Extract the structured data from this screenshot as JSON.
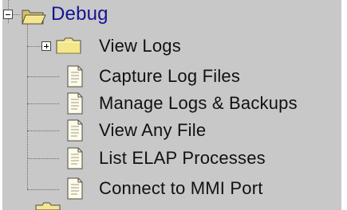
{
  "tree": {
    "root": {
      "label": "Debug",
      "icon": "open-folder-icon",
      "expander": "minus"
    },
    "children": [
      {
        "label": "View Logs",
        "icon": "folder-icon",
        "expander": "plus"
      },
      {
        "label": "Capture Log Files",
        "icon": "document-icon"
      },
      {
        "label": "Manage Logs & Backups",
        "icon": "document-icon"
      },
      {
        "label": "View Any File",
        "icon": "document-icon"
      },
      {
        "label": "List ELAP Processes",
        "icon": "document-icon"
      },
      {
        "label": "Connect to MMI Port",
        "icon": "document-icon"
      }
    ],
    "colors": {
      "background": "#c8c8c8",
      "root_text": "#141496",
      "child_text": "#111111"
    }
  }
}
